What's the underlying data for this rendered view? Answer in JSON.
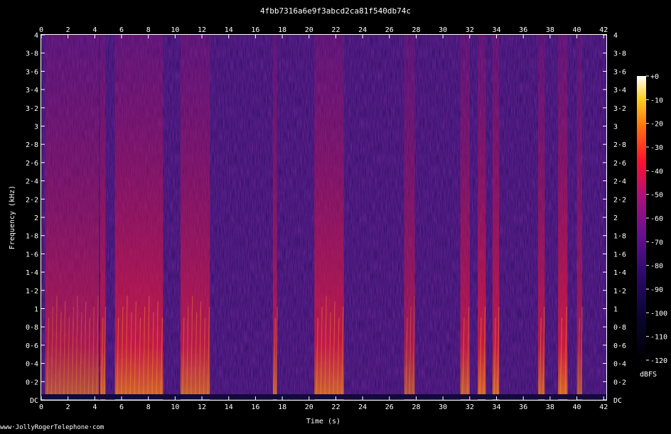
{
  "chart_data": {
    "type": "heatmap",
    "title": "4fbb7316a6e9f3abcd2ca81f540db74c",
    "xlabel": "Time (s)",
    "ylabel": "Frequency (kHz)",
    "xlim": [
      0,
      42.2
    ],
    "ylim": [
      0,
      4
    ],
    "x_ticks": [
      "0",
      "2",
      "4",
      "6",
      "8",
      "10",
      "12",
      "14",
      "16",
      "18",
      "20",
      "22",
      "24",
      "26",
      "28",
      "30",
      "32",
      "34",
      "36",
      "38",
      "40",
      "42"
    ],
    "y_ticks": [
      "DC",
      "0·2",
      "0·4",
      "0·6",
      "0·8",
      "1",
      "1·2",
      "1·4",
      "1·6",
      "1·8",
      "2",
      "2·2",
      "2·4",
      "2·6",
      "2·8",
      "3",
      "3·2",
      "3·4",
      "3·6",
      "3·8",
      "4"
    ],
    "colorbar": {
      "label": "dBFS",
      "range": [
        -120,
        0
      ],
      "ticks": [
        "+0",
        "-10",
        "-20",
        "-30",
        "-40",
        "-50",
        "-60",
        "-70",
        "-80",
        "-90",
        "-100",
        "-110",
        "-120"
      ]
    },
    "energy_segments": [
      {
        "start": 0.3,
        "end": 4.3,
        "intensity": 0.62
      },
      {
        "start": 4.4,
        "end": 4.8,
        "intensity": 0.75
      },
      {
        "start": 5.5,
        "end": 9.1,
        "intensity": 0.78
      },
      {
        "start": 10.4,
        "end": 12.6,
        "intensity": 0.72
      },
      {
        "start": 17.3,
        "end": 17.6,
        "intensity": 0.7
      },
      {
        "start": 20.4,
        "end": 22.6,
        "intensity": 0.76
      },
      {
        "start": 27.1,
        "end": 27.9,
        "intensity": 0.6
      },
      {
        "start": 31.3,
        "end": 32.0,
        "intensity": 0.72
      },
      {
        "start": 32.6,
        "end": 33.2,
        "intensity": 0.8
      },
      {
        "start": 33.7,
        "end": 34.2,
        "intensity": 0.78
      },
      {
        "start": 37.1,
        "end": 37.6,
        "intensity": 0.72
      },
      {
        "start": 38.6,
        "end": 39.3,
        "intensity": 0.82
      },
      {
        "start": 40.0,
        "end": 40.4,
        "intensity": 0.6
      }
    ]
  },
  "watermark": "www·JollyRogerTelephone·com"
}
